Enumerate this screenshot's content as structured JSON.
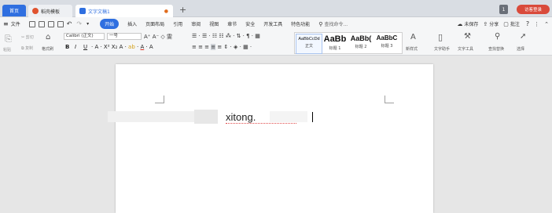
{
  "tabs": {
    "home": "首页",
    "template": "稻壳模板",
    "document": "文字文稿1",
    "add": "+"
  },
  "titlebar": {
    "badge": "1",
    "login": "访客登录"
  },
  "menu": {
    "file": "文件",
    "items": [
      "开始",
      "插入",
      "页面布局",
      "引用",
      "审阅",
      "视图",
      "章节",
      "安全",
      "开发工具",
      "特色功能"
    ],
    "search": "查找命令...",
    "unsaved": "未保存",
    "share": "分享",
    "comment": "批注",
    "help": "?"
  },
  "ribbon": {
    "paste": "粘贴",
    "cut": "剪切",
    "copy": "复制",
    "format_painter": "格式刷",
    "font_name": "Calibri (正文)",
    "font_size": "一号",
    "styles": [
      {
        "sample": "AaBbCcDd",
        "name": "正文"
      },
      {
        "sample": "AaBb",
        "name": "标题 1"
      },
      {
        "sample": "AaBb(",
        "name": "标题 2"
      },
      {
        "sample": "AaBbC",
        "name": "标题 3"
      }
    ],
    "new_style": "新样式",
    "text_assistant": "文字助手",
    "text_tools": "文字工具",
    "find_replace": "查找替换",
    "select": "选择"
  },
  "document": {
    "text": "xitong."
  },
  "colors": {
    "accent": "#2f6fe0",
    "login": "#d94a3b",
    "doc_icon": "#2f6fe0",
    "template_icon": "#e0532f"
  }
}
